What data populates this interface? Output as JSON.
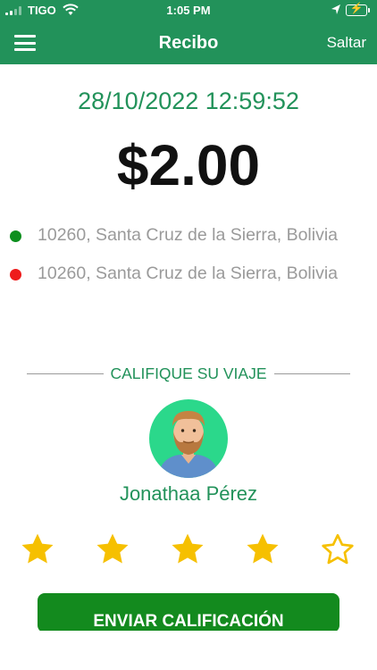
{
  "status_bar": {
    "carrier": "TIGO",
    "time": "1:05 PM"
  },
  "header": {
    "title": "Recibo",
    "skip_label": "Saltar"
  },
  "receipt": {
    "datetime": "28/10/2022 12:59:52",
    "amount": "$2.00"
  },
  "route": {
    "origin": "10260, Santa Cruz de la Sierra, Bolivia",
    "destination": "10260, Santa Cruz de la Sierra, Bolivia",
    "origin_color": "#0d8f1e",
    "destination_color": "#ee1b1b"
  },
  "rating": {
    "heading": "CALIFIQUE SU VIAJE",
    "driver_name": "Jonathaa Pérez",
    "stars_selected": 4,
    "stars_total": 5,
    "star_color": "#f6c000"
  },
  "submit_label": "ENVIAR CALIFICACIÓN",
  "colors": {
    "brand": "#22925a",
    "button": "#138a1e"
  }
}
